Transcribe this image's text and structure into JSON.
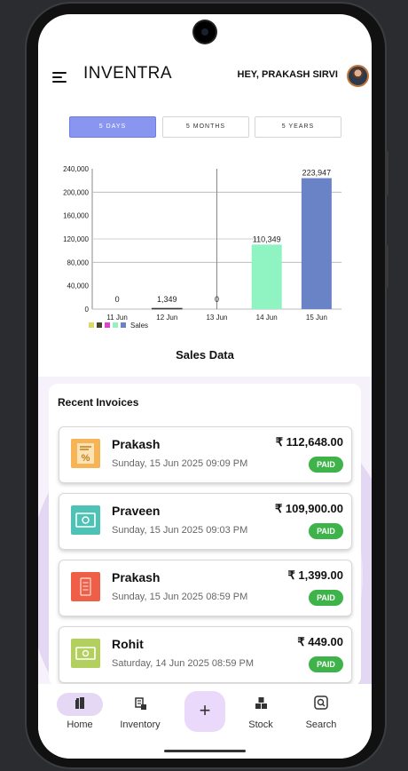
{
  "app": {
    "title": "INVENTRA",
    "greeting": "HEY, PRAKASH SIRVI"
  },
  "range_tabs": [
    {
      "label": "5 DAYS",
      "active": true
    },
    {
      "label": "5 MONTHS",
      "active": false
    },
    {
      "label": "5 YEARS",
      "active": false
    }
  ],
  "chart_data": {
    "type": "bar",
    "title": "Sales Data",
    "categories": [
      "11 Jun",
      "12 Jun",
      "13 Jun",
      "14 Jun",
      "15 Jun"
    ],
    "series": [
      {
        "name": "Sales",
        "values": [
          0,
          1349,
          0,
          110349,
          223947
        ]
      }
    ],
    "value_labels": [
      "0",
      "1,349",
      "0",
      "110,349",
      "223,947"
    ],
    "yticks": [
      "0",
      "40,000",
      "80,000",
      "120,000",
      "160,000",
      "200,000",
      "240,000"
    ],
    "ylim": [
      0,
      240000
    ],
    "bar_colors": [
      "#dcd860",
      "#4a4230",
      "#e03fcf",
      "#8ff3c2",
      "#6a82c6"
    ],
    "legend_position": "bottom-left",
    "grid": "partial"
  },
  "invoices": {
    "title": "Recent Invoices",
    "items": [
      {
        "name": "Prakash",
        "date": "Sunday, 15 Jun 2025 09:09 PM",
        "amount": "₹ 112,648.00",
        "status": "PAID",
        "icon": "discount-receipt-icon",
        "icon_color": "#f6b456"
      },
      {
        "name": "Praveen",
        "date": "Sunday, 15 Jun 2025 09:03 PM",
        "amount": "₹ 109,900.00",
        "status": "PAID",
        "icon": "cash-icon",
        "icon_color": "#4fc2b6"
      },
      {
        "name": "Prakash",
        "date": "Sunday, 15 Jun 2025 08:59 PM",
        "amount": "₹ 1,399.00",
        "status": "PAID",
        "icon": "bill-icon",
        "icon_color": "#ef5e47"
      },
      {
        "name": "Rohit",
        "date": "Saturday, 14 Jun 2025 08:59 PM",
        "amount": "₹ 449.00",
        "status": "PAID",
        "icon": "banknote-icon",
        "icon_color": "#b3cf5e"
      }
    ]
  },
  "nav": {
    "items": [
      {
        "label": "Home",
        "icon": "home-icon",
        "active": true
      },
      {
        "label": "Inventory",
        "icon": "inventory-icon",
        "active": false
      },
      {
        "label": "Stock",
        "icon": "stock-icon",
        "active": false
      },
      {
        "label": "Search",
        "icon": "search-icon",
        "active": false
      }
    ],
    "fab_label": "+"
  },
  "colors": {
    "accent": "#8896ef",
    "paid": "#3db34a",
    "nav_active": "#e4d8f5"
  }
}
